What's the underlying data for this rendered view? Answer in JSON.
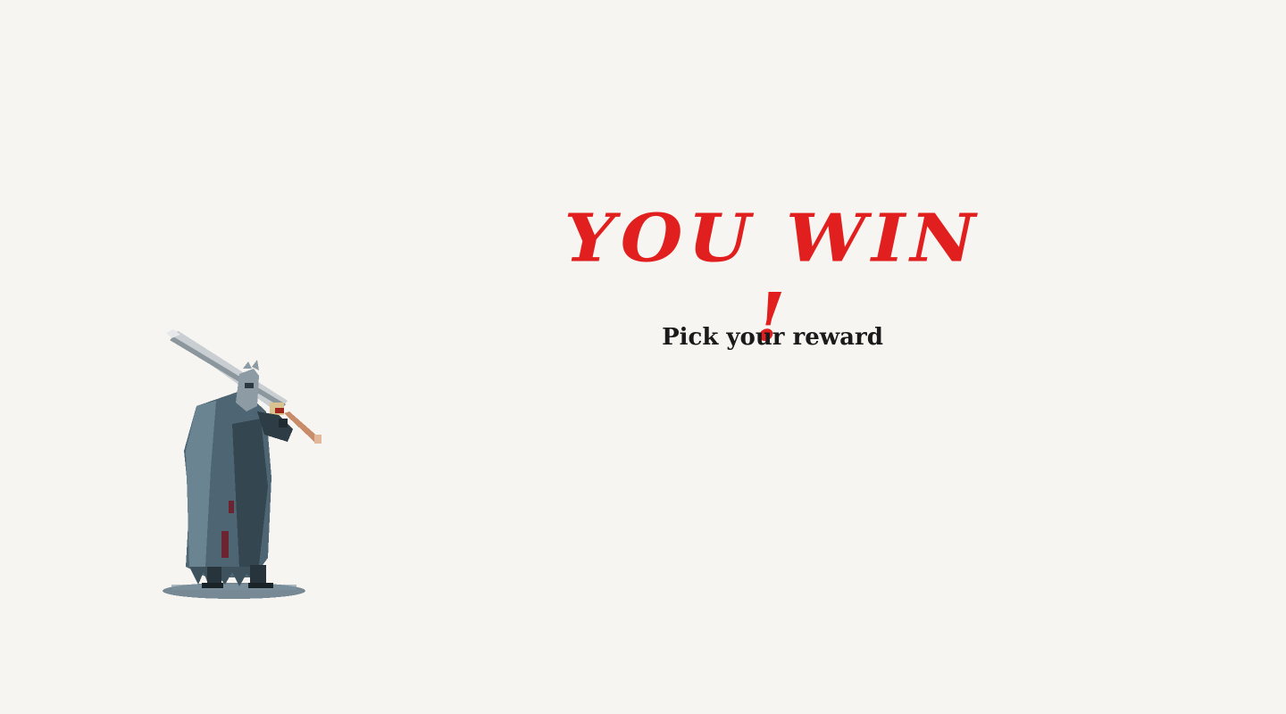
{
  "screen": {
    "title": "YOU WIN !",
    "subtitle": "Pick your reward"
  },
  "colors": {
    "background": "#f7f5f1",
    "title": "#e21f1f",
    "subtitle": "#1a1a1a"
  },
  "sprite": {
    "icon": "greatsword-knight-sprite"
  }
}
